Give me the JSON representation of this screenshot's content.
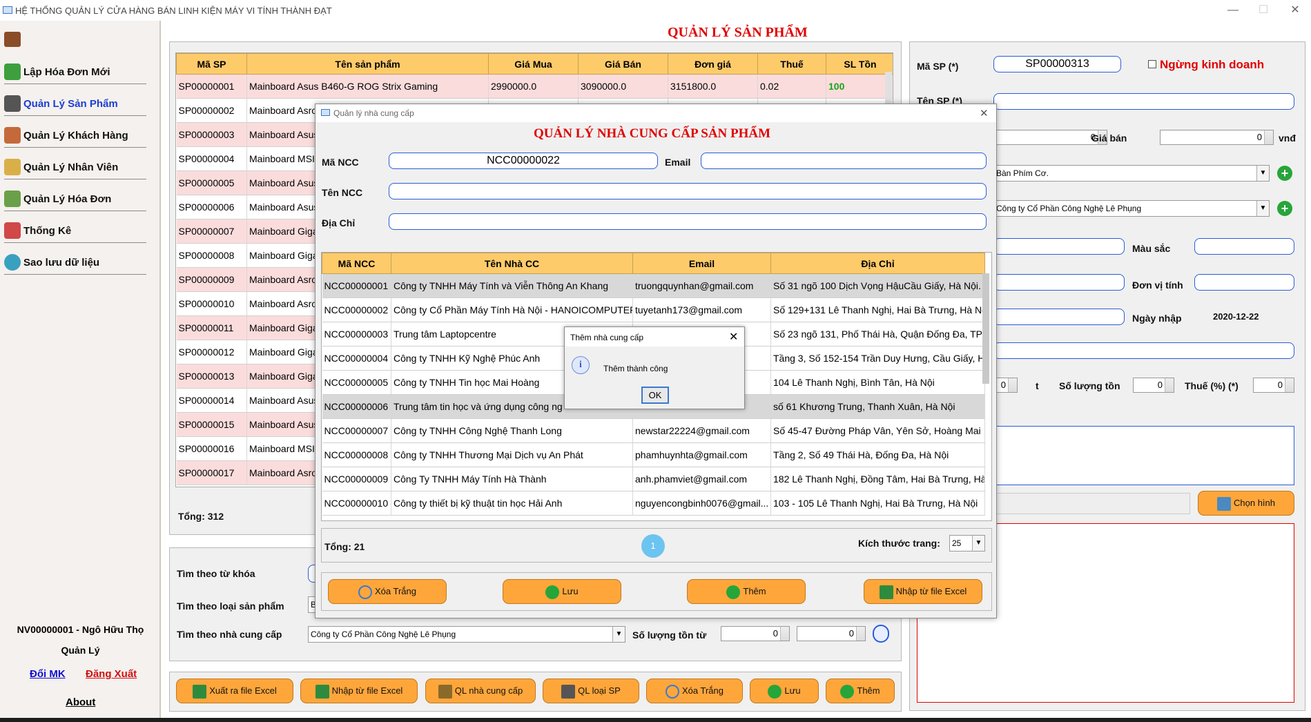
{
  "window": {
    "title": "HỆ THỐNG QUẢN LÝ CỬA HÀNG BÁN LINH KIỆN MÁY VI TÍNH THÀNH ĐẠT"
  },
  "sidebar": {
    "items": [
      {
        "label": "Lập Hóa Đơn Mới",
        "icon": "cart-icon"
      },
      {
        "label": "Quản Lý Sản Phẩm",
        "icon": "product-icon"
      },
      {
        "label": "Quản Lý Khách Hàng",
        "icon": "customers-icon"
      },
      {
        "label": "Quản Lý Nhân Viên",
        "icon": "employee-icon"
      },
      {
        "label": "Quản Lý Hóa Đơn",
        "icon": "invoice-icon"
      },
      {
        "label": "Thống Kê",
        "icon": "chart-icon"
      },
      {
        "label": "Sao lưu dữ liệu",
        "icon": "cloud-icon"
      }
    ],
    "user": "NV00000001 - Ngô Hữu  Thọ",
    "role": "Quản Lý",
    "change_password": "Đổi MK",
    "logout": "Đăng Xuất",
    "about": "About"
  },
  "product": {
    "heading": "QUẢN LÝ SẢN PHẨM",
    "columns": [
      "Mã SP",
      "Tên sản phẩm",
      "Giá Mua",
      "Giá Bán",
      "Đơn giá",
      "Thuế",
      "SL Tồn"
    ],
    "first_row": {
      "id": "SP00000001",
      "name": "Mainboard Asus B460-G ROG Strix Gaming",
      "buy": "2990000.0",
      "sell": "3090000.0",
      "unit": "3151800.0",
      "tax": "0.02",
      "stock": "100"
    },
    "rows": [
      {
        "id": "SP00000002",
        "name": "Mainboard Asro"
      },
      {
        "id": "SP00000003",
        "name": "Mainboard Asus"
      },
      {
        "id": "SP00000004",
        "name": "Mainboard MSI"
      },
      {
        "id": "SP00000005",
        "name": "Mainboard Asus"
      },
      {
        "id": "SP00000006",
        "name": "Mainboard Asus"
      },
      {
        "id": "SP00000007",
        "name": "Mainboard Giga"
      },
      {
        "id": "SP00000008",
        "name": "Mainboard Giga"
      },
      {
        "id": "SP00000009",
        "name": "Mainboard Asro"
      },
      {
        "id": "SP00000010",
        "name": "Mainboard Asro"
      },
      {
        "id": "SP00000011",
        "name": "Mainboard Giga"
      },
      {
        "id": "SP00000012",
        "name": "Mainboard Giga"
      },
      {
        "id": "SP00000013",
        "name": "Mainboard Giga"
      },
      {
        "id": "SP00000014",
        "name": "Mainboard Asus"
      },
      {
        "id": "SP00000015",
        "name": "Mainboard Asus"
      },
      {
        "id": "SP00000016",
        "name": "Mainboard MSI"
      },
      {
        "id": "SP00000017",
        "name": "Mainboard Asro"
      }
    ],
    "total": "Tổng: 312",
    "search": {
      "keyword_label": "Tìm theo từ khóa",
      "category_label": "Tìm theo loại sản phẩm",
      "category_value": "B",
      "supplier_label": "Tìm theo nhà cung cấp",
      "supplier_value": "Công ty Cổ Phần Công Nghệ Lê Phụng",
      "stock_label": "Số lượng tồn từ",
      "stock_from": "0",
      "stock_to": "0"
    },
    "buttons": [
      "Xuất ra file Excel",
      "Nhập từ file Excel",
      "QL nhà cung cấp",
      "QL loại SP",
      "Xóa Trắng",
      "Lưu",
      "Thêm"
    ]
  },
  "detail": {
    "id_label": "Mã SP (*)",
    "id_value": "SP00000313",
    "discontinued_label": "Ngừng kinh doanh",
    "name_label": "Tên SP (*)",
    "buy_value": "0",
    "sell_label": "Giá bán",
    "sell_value": "0",
    "currency": "vnđ",
    "category_value": "Bàn Phím Cơ.",
    "supplier_value": "Công ty Cổ Phần Công Nghệ Lê Phụng",
    "color_label": "Màu sắc",
    "unit_label": "Đơn vị tính",
    "date_label": "Ngày nhập",
    "date_value": "2020-12-22",
    "min_value": "0",
    "min_suffix": "t",
    "stock_label": "Số lượng tồn",
    "stock_value": "0",
    "tax_label": "Thuế (%) (*)",
    "tax_value": "0",
    "choose_image": "Chọn hình"
  },
  "ncc_dialog": {
    "title": "Quản lý nhà cung cấp",
    "heading": "QUẢN LÝ NHÀ CUNG CẤP SẢN PHẨM",
    "id_label": "Mã NCC",
    "id_value": "NCC00000022",
    "email_label": "Email",
    "name_label": "Tên NCC",
    "address_label": "Địa Chỉ",
    "columns": [
      "Mã NCC",
      "Tên Nhà CC",
      "Email",
      "Địa Chỉ"
    ],
    "rows": [
      {
        "id": "NCC00000001",
        "name": "Công ty TNHH Máy Tính và Viễn Thông An Khang",
        "email": "truongquynhan@gmail.com",
        "addr": "Số 31 ngõ 100 Dịch Vọng HậuCầu Giấy, Hà Nội."
      },
      {
        "id": "NCC00000002",
        "name": "Công ty Cổ Phần Máy Tính Hà Nội - HANOICOMPUTER",
        "email": "tuyetanh173@gmail.com",
        "addr": "Số 129+131 Lê Thanh Nghị, Hai Bà Trưng, Hà Nội"
      },
      {
        "id": "NCC00000003",
        "name": "Trung tâm Laptopcentre",
        "email": "",
        "addr": "Số 23 ngõ 131, Phố Thái Hà, Quận Đống Đa, TP Hà Nội"
      },
      {
        "id": "NCC00000004",
        "name": "Công ty TNHH Kỹ Nghệ Phúc Anh",
        "email": "om",
        "addr": "Tầng 3, Số 152-154 Trần Duy Hưng, Cầu Giấy, Hà Nội"
      },
      {
        "id": "NCC00000005",
        "name": "Công ty TNHH Tin học Mai Hoàng",
        "email": "",
        "addr": "104 Lê Thanh Nghị, Bình Tân, Hà Nội"
      },
      {
        "id": "NCC00000006",
        "name": "Trung tâm tin học và ứng dụng công ng",
        "email": "",
        "addr": "số 61 Khương Trung, Thanh Xuân, Hà Nội"
      },
      {
        "id": "NCC00000007",
        "name": "Công ty TNHH Công Nghệ Thanh Long",
        "email": "newstar22224@gmail.com",
        "addr": "Số 45-47 Đường Pháp Vân, Yên Sở, Hoàng Mai"
      },
      {
        "id": "NCC00000008",
        "name": "Công ty TNHH Thương Mại Dịch vụ An Phát",
        "email": "phamhuynhta@gmail.com",
        "addr": "Tầng 2, Số 49 Thái Hà, Đống Đa, Hà Nội"
      },
      {
        "id": "NCC00000009",
        "name": "Công Ty TNHH Máy Tính Hà Thành",
        "email": "anh.phamviet@gmail.com",
        "addr": "182 Lê Thanh Nghị, Đồng Tâm, Hai Bà Trưng, Hà Nội"
      },
      {
        "id": "NCC00000010",
        "name": "Công ty thiết bị kỹ thuật tin học Hải Anh",
        "email": "nguyencongbinh0076@gmail...",
        "addr": "103 - 105 Lê Thanh Nghị, Hai Bà Trưng, Hà Nội"
      }
    ],
    "total": "Tổng: 21",
    "page": "1",
    "page_size_label": "Kích thước trang:",
    "page_size": "25",
    "buttons": [
      "Xóa Trắng",
      "Lưu",
      "Thêm",
      "Nhập từ file Excel"
    ]
  },
  "message": {
    "title": "Thêm nhà cung cấp",
    "text": "Thêm thành công",
    "ok": "OK"
  },
  "colors": {
    "header": "#fecb6b",
    "accent_red": "#e00000",
    "button_orange": "#ffa63b",
    "stock_green": "#19a319"
  }
}
